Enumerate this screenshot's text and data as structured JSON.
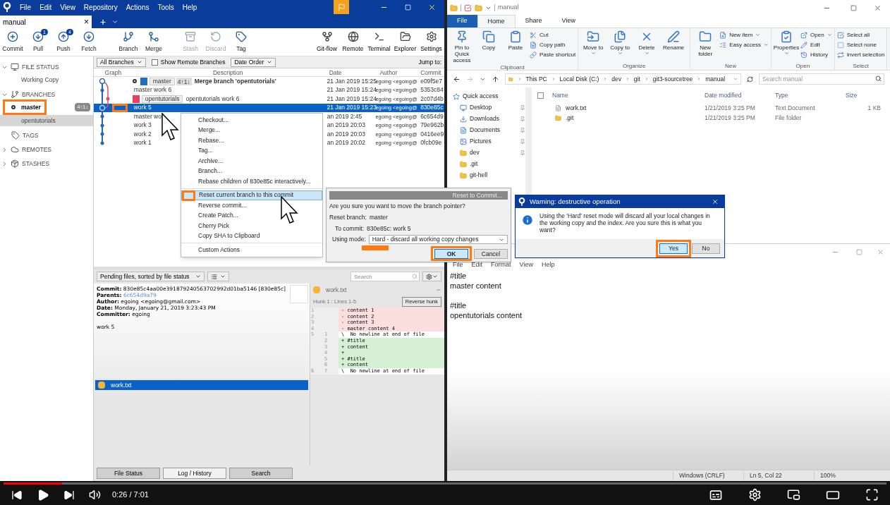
{
  "sourcetree": {
    "menu": [
      "File",
      "Edit",
      "View",
      "Repository",
      "Actions",
      "Tools",
      "Help"
    ],
    "tab": {
      "label": "manual",
      "close": "×",
      "add": "+"
    },
    "toolbar_left": [
      {
        "label": "Commit",
        "disabled": false
      },
      {
        "label": "Pull",
        "disabled": false,
        "badge": "1"
      },
      {
        "label": "Push",
        "disabled": false,
        "badge": "4"
      },
      {
        "label": "Fetch",
        "disabled": false
      },
      {
        "label": "Branch",
        "disabled": false
      },
      {
        "label": "Merge",
        "disabled": false
      },
      {
        "label": "Stash",
        "disabled": true
      },
      {
        "label": "Discard",
        "disabled": true
      },
      {
        "label": "Tag",
        "disabled": false
      }
    ],
    "toolbar_right": [
      {
        "label": "Git-flow"
      },
      {
        "label": "Remote"
      },
      {
        "label": "Terminal"
      },
      {
        "label": "Explorer"
      },
      {
        "label": "Settings"
      }
    ],
    "sidebar": [
      {
        "label": "FILE STATUS",
        "expanded": true,
        "children": [
          {
            "label": "Working Copy",
            "selected": false
          }
        ]
      },
      {
        "label": "BRANCHES",
        "expanded": true,
        "children": [
          {
            "label": "master",
            "selected": false,
            "current": true,
            "badge": "4↑1↓"
          },
          {
            "label": "opentutorials",
            "selected": true,
            "current": false
          }
        ]
      },
      {
        "label": "TAGS"
      },
      {
        "label": "REMOTES",
        "expanded": false
      },
      {
        "label": "STASHES",
        "expanded": false
      }
    ],
    "filters": {
      "branches": "All Branches",
      "show_remote": {
        "label": "Show Remote Branches",
        "checked": false
      },
      "order": "Date Order",
      "jump": "Jump to:"
    },
    "columns": [
      "Graph",
      "Description",
      "Date",
      "Author",
      "Commit"
    ],
    "commits": [
      {
        "head": true,
        "branch": {
          "label": "master",
          "color": "#1f6fc0"
        },
        "ahead_behind": "4↑1↓",
        "description": "Merge branch 'opentutorials'",
        "bold": true,
        "date": "21 Jan 2019 15:25",
        "author": "egoing <egoing@",
        "hash": "e09f5e7",
        "selected": false
      },
      {
        "head": false,
        "description": "master work 6",
        "bold": false,
        "date": "21 Jan 2019 15:24",
        "author": "egoing <egoing@",
        "hash": "5353c84",
        "selected": false
      },
      {
        "head": false,
        "branch": {
          "label": "opentutorials",
          "color": "#e8405e"
        },
        "description": "opentutorials work 6",
        "bold": false,
        "date": "21 Jan 2019 15:24",
        "author": "egoing <egoing@",
        "hash": "2c07d4b",
        "selected": false
      },
      {
        "head": false,
        "description": "work 5",
        "bold": false,
        "date": "21 Jan 2019 15:23",
        "author": "egoing <egoing@",
        "hash": "830e85c",
        "selected": true
      },
      {
        "head": false,
        "description": "master wo",
        "bold": false,
        "date": "an 2019 2:45",
        "author": "egoing <egoing@",
        "hash": "6c654d9",
        "selected": false
      },
      {
        "head": false,
        "description": "work 3",
        "bold": false,
        "date": "an 2019 20:03",
        "author": "egoing <egoing@",
        "hash": "79e962b",
        "selected": false
      },
      {
        "head": false,
        "description": "work 2",
        "bold": false,
        "date": "an 2019 20:03",
        "author": "egoing <egoing@",
        "hash": "0416ee9",
        "selected": false
      },
      {
        "head": false,
        "description": "work 1",
        "bold": false,
        "date": "an 2019 20:02",
        "author": "egoing <egoing@",
        "hash": "0fcb09e",
        "selected": false
      }
    ],
    "context_menu": [
      [
        {
          "label": "Checkout...",
          "highlighted": false
        },
        {
          "label": "Merge...",
          "highlighted": false
        },
        {
          "label": "Rebase...",
          "highlighted": false
        },
        {
          "label": "Tag...",
          "highlighted": false
        },
        {
          "label": "Archive...",
          "highlighted": false
        },
        {
          "label": "Branch...",
          "highlighted": false
        },
        {
          "label": "Rebase children of 830e85c interactively...",
          "highlighted": false
        }
      ],
      [
        {
          "label": "Reset current branch to this commit",
          "highlighted": true
        },
        {
          "label": "Reverse commit...",
          "highlighted": false
        },
        {
          "label": "Create Patch...",
          "highlighted": false
        },
        {
          "label": "Cherry Pick",
          "highlighted": false
        },
        {
          "label": "Copy SHA to Clipboard",
          "highlighted": false
        }
      ],
      [
        {
          "label": "Custom Actions",
          "highlighted": false
        }
      ]
    ],
    "pending": {
      "label": "Pending files, sorted by file status",
      "search_placeholder": "Search"
    },
    "details": [
      {
        "label": "Commit:",
        "value": "830e85c4aa00e391879240563702992d01ba5146 [830e85c]",
        "kind": "text"
      },
      {
        "label": "Parents:",
        "value": "6c654d9a79",
        "kind": "link"
      },
      {
        "label": "Author:",
        "value": "egoing <egoing@gmail.com>",
        "kind": "text"
      },
      {
        "label": "Date:",
        "value": "Monday, January 21, 2019 3:23:43 PM",
        "kind": "text"
      },
      {
        "label": "Committer:",
        "value": "egoing",
        "kind": "text"
      }
    ],
    "message": "work 5",
    "files": [
      {
        "name": "work.txt",
        "selected": true
      }
    ],
    "diff": {
      "file": "work.txt",
      "hunk": "Hunk 1 : Lines 1-5",
      "reverse": "Reverse hunk",
      "lines": [
        {
          "old": "1",
          "text": "- content 1",
          "kind": "removed"
        },
        {
          "old": "2",
          "text": "- content 2",
          "kind": "removed"
        },
        {
          "old": "3",
          "text": "- content 3",
          "kind": "removed"
        },
        {
          "old": "4",
          "text": "- master content 4",
          "kind": "removed"
        },
        {
          "old": "5",
          "new": "1",
          "text": "\\  No newline at end of file",
          "kind": "context"
        },
        {
          "new": "2",
          "text": "+ #title",
          "kind": "added"
        },
        {
          "new": "3",
          "text": "+ content",
          "kind": "added"
        },
        {
          "new": "4",
          "text": "+",
          "kind": "added"
        },
        {
          "new": "5",
          "text": "+ #title",
          "kind": "added"
        },
        {
          "new": "6",
          "text": "+ content",
          "kind": "added"
        },
        {
          "old": "6",
          "new": "7",
          "text": "\\  No newline at end of file",
          "kind": "context"
        }
      ]
    },
    "bottom_tabs": [
      {
        "label": "File Status",
        "selected": false
      },
      {
        "label": "Log / History",
        "selected": true
      },
      {
        "label": "Search",
        "selected": false
      }
    ]
  },
  "reset_dialog": {
    "title": "Reset to Commit...",
    "question": "Are you sure you want to move the branch pointer?",
    "fields": [
      {
        "label": "Reset branch:",
        "value": "master"
      },
      {
        "label": "To commit:",
        "value": "830e85c: work 5"
      }
    ],
    "mode_label": "Using mode:",
    "mode": "Hard - discard all working copy changes",
    "buttons": [
      {
        "label": "OK",
        "focused": true
      },
      {
        "label": "Cancel",
        "focused": false
      }
    ]
  },
  "warning_dialog": {
    "title": "Warning: destructive operation",
    "message": "Using the 'Hard' reset mode will discard all your local changes in the working copy and the index. Are you sure this is what you want?",
    "buttons": [
      {
        "label": "Yes",
        "focused": true
      },
      {
        "label": "No",
        "focused": false
      }
    ]
  },
  "explorer": {
    "title": "manual",
    "tabs": [
      {
        "label": "File",
        "kind": "file",
        "selected": false
      },
      {
        "label": "Home",
        "kind": "tab",
        "selected": true
      },
      {
        "label": "Share",
        "kind": "tab",
        "selected": false
      },
      {
        "label": "View",
        "kind": "tab",
        "selected": false
      }
    ],
    "groups": [
      {
        "label": "Clipboard",
        "items": [
          {
            "label": "Pin to Quick access",
            "kind": "large",
            "menu": false
          },
          {
            "label": "Copy",
            "kind": "large",
            "menu": false
          },
          {
            "label": "Paste",
            "kind": "large",
            "menu": false
          },
          {
            "label": "Cut",
            "kind": "small",
            "menu": false
          },
          {
            "label": "Copy path",
            "kind": "small",
            "menu": false
          },
          {
            "label": "Paste shortcut",
            "kind": "small",
            "menu": false
          }
        ]
      },
      {
        "label": "Organize",
        "items": [
          {
            "label": "Move to",
            "kind": "large",
            "menu": true
          },
          {
            "label": "Copy to",
            "kind": "large",
            "menu": true
          },
          {
            "label": "Delete",
            "kind": "large",
            "menu": true
          },
          {
            "label": "Rename",
            "kind": "large",
            "menu": false
          }
        ]
      },
      {
        "label": "New",
        "items": [
          {
            "label": "New folder",
            "kind": "large",
            "menu": false
          },
          {
            "label": "New item",
            "kind": "small",
            "menu": true
          },
          {
            "label": "Easy access",
            "kind": "small",
            "menu": true
          }
        ]
      },
      {
        "label": "Open",
        "items": [
          {
            "label": "Properties",
            "kind": "large",
            "menu": true
          },
          {
            "label": "Open",
            "kind": "small",
            "menu": true
          },
          {
            "label": "Edit",
            "kind": "small",
            "menu": false
          },
          {
            "label": "History",
            "kind": "small",
            "menu": false
          }
        ]
      },
      {
        "label": "Select",
        "items": [
          {
            "label": "Select all",
            "kind": "small",
            "menu": false
          },
          {
            "label": "Select none",
            "kind": "small",
            "menu": false
          },
          {
            "label": "Invert selection",
            "kind": "small",
            "menu": false
          }
        ]
      }
    ],
    "path": [
      "This PC",
      "Local Disk (C:)",
      "dev",
      "git",
      "git3-sourcetree",
      "manual"
    ],
    "search_placeholder": "Search manual",
    "nav": [
      {
        "label": "Quick access",
        "kind": "star",
        "pinned": false
      },
      {
        "label": "Desktop",
        "kind": "desktop",
        "pinned": true
      },
      {
        "label": "Downloads",
        "kind": "download",
        "pinned": true
      },
      {
        "label": "Documents",
        "kind": "document",
        "pinned": true
      },
      {
        "label": "Pictures",
        "kind": "picture",
        "pinned": true
      },
      {
        "label": "dev",
        "kind": "folder",
        "pinned": true
      },
      {
        "label": ".git",
        "kind": "folder",
        "pinned": false
      },
      {
        "label": "git-hell",
        "kind": "folder",
        "pinned": false
      }
    ],
    "select_all": {
      "checked": false
    },
    "columns": [
      "Name",
      "Date modified",
      "Type",
      "Size"
    ],
    "files": [
      {
        "name": "work.txt",
        "date": "1/21/2019 3:25 PM",
        "type": "Text Document",
        "size": "1 KB",
        "kind": "file"
      },
      {
        "name": ".git",
        "date": "1/21/2019 3:25 PM",
        "type": "File folder",
        "kind": "folder"
      }
    ]
  },
  "notepad": {
    "menu": [
      "File",
      "Edit",
      "Format",
      "View",
      "Help"
    ],
    "paragraphs": [
      [
        "#title",
        "master content"
      ],
      [
        "#title",
        "opentutorials content"
      ]
    ],
    "status": [
      "Windows (CRLF)",
      "Ln 5, Col 22",
      "100%"
    ]
  },
  "player": {
    "level": 0.066,
    "time": "0:26 / 7:01"
  }
}
